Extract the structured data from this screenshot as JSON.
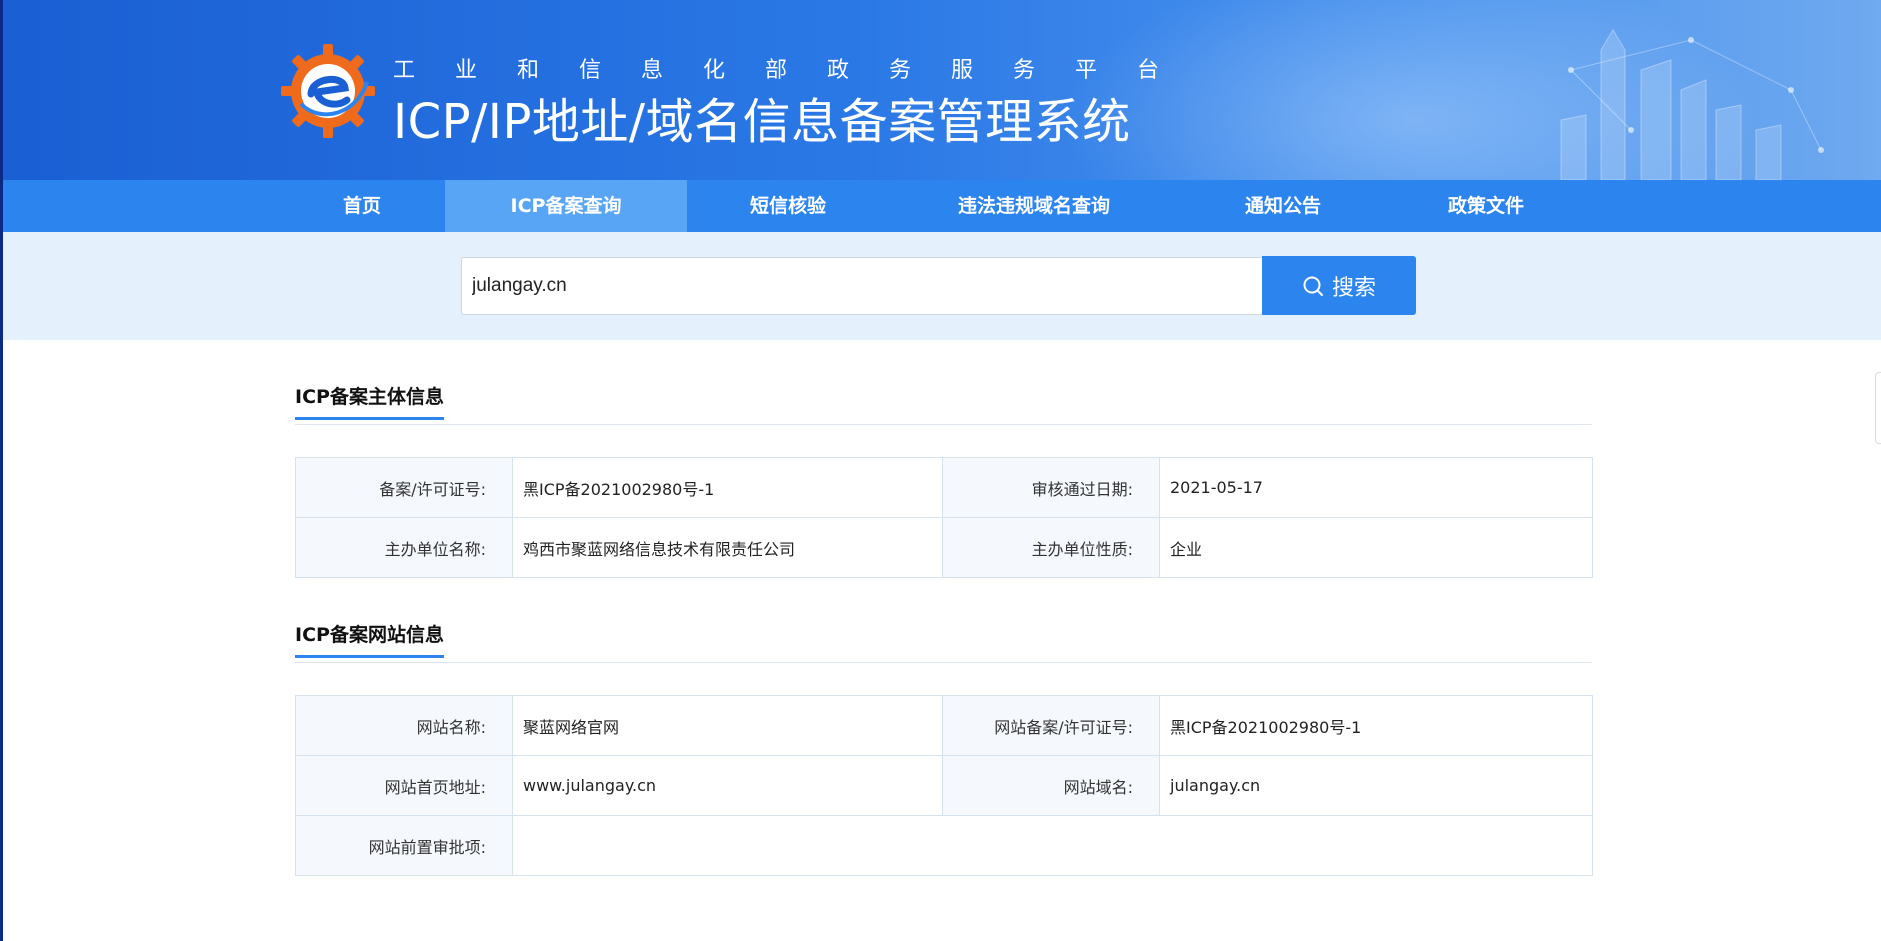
{
  "header": {
    "subtitle": "工业和信息化部政务服务平台",
    "title": "ICP/IP地址/域名信息备案管理系统"
  },
  "nav": {
    "items": [
      {
        "label": "首页"
      },
      {
        "label": "ICP备案查询"
      },
      {
        "label": "短信核验"
      },
      {
        "label": "违法违规域名查询"
      },
      {
        "label": "通知公告"
      },
      {
        "label": "政策文件"
      }
    ],
    "active": "ICP备案查询"
  },
  "search": {
    "value": "julangay.cn",
    "button_label": "搜索",
    "icon": "search-icon"
  },
  "subject_section": {
    "title": "ICP备案主体信息",
    "rows": [
      {
        "label1": "备案/许可证号:",
        "value1": "黑ICP备2021002980号-1",
        "label2": "审核通过日期:",
        "value2": "2021-05-17"
      },
      {
        "label1": "主办单位名称:",
        "value1": "鸡西市聚蓝网络信息技术有限责任公司",
        "label2": "主办单位性质:",
        "value2": "企业"
      }
    ]
  },
  "website_section": {
    "title": "ICP备案网站信息",
    "rows": [
      {
        "label1": "网站名称:",
        "value1": "聚蓝网络官网",
        "label2": "网站备案/许可证号:",
        "value2": "黑ICP备2021002980号-1"
      },
      {
        "label1": "网站首页地址:",
        "value1": "www.julangay.cn",
        "label2": "网站域名:",
        "value2": "julangay.cn"
      }
    ],
    "preapproval_label": "网站前置审批项:",
    "preapproval_value": ""
  },
  "colors": {
    "brand_blue": "#2c85ef",
    "nav_active": "#57a5f4",
    "search_band": "#e4f0fc",
    "logo_orange": "#f06a1c"
  }
}
